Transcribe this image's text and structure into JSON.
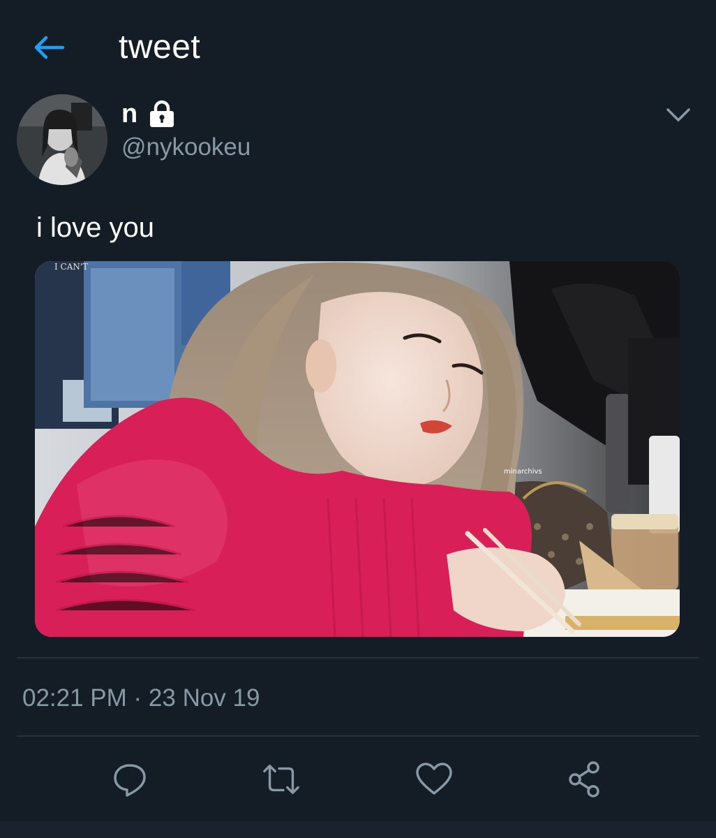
{
  "header": {
    "title": "tweet",
    "back_icon": "arrow-left-icon"
  },
  "colors": {
    "background": "#141d26",
    "accent": "#1da1f2",
    "secondary_text": "#8899a6",
    "divider": "#253341",
    "sweater": "#d81f58"
  },
  "author": {
    "display_name": "n",
    "protected_icon": "lock-icon",
    "handle": "@nykookeu",
    "caret_icon": "chevron-down-icon"
  },
  "tweet": {
    "text": "i love you",
    "media": {
      "overlay_text_top": "I CAN'T",
      "watermark": "minarchivs"
    },
    "timestamp": "02:21 PM · 23 Nov 19"
  },
  "actions": [
    {
      "name": "reply",
      "icon": "reply-icon"
    },
    {
      "name": "retweet",
      "icon": "retweet-icon"
    },
    {
      "name": "like",
      "icon": "heart-icon"
    },
    {
      "name": "share",
      "icon": "share-icon"
    }
  ]
}
